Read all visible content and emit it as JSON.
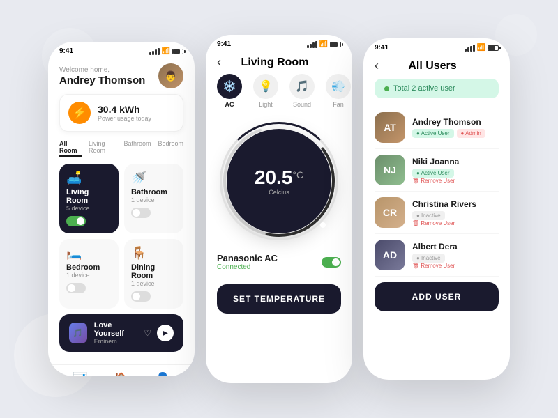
{
  "background": "#e8eaf0",
  "phone1": {
    "time": "9:41",
    "welcome": "Welcome home,",
    "userName": "Andrey Thomson",
    "power": {
      "value": "30.4 kWh",
      "label": "Power usage today"
    },
    "tabs": [
      "All Room",
      "Living Room",
      "Bathroom",
      "Bedroom"
    ],
    "activeTab": "All Room",
    "rooms": [
      {
        "name": "Living Room",
        "devices": "5 device",
        "icon": "🛋️",
        "dark": true,
        "on": true
      },
      {
        "name": "Bathroom",
        "devices": "1 device",
        "icon": "🚿",
        "dark": false,
        "on": false
      },
      {
        "name": "Bedroom",
        "devices": "1 device",
        "icon": "🛏️",
        "dark": false,
        "on": false
      },
      {
        "name": "Dining Room",
        "devices": "1 device",
        "icon": "🪑",
        "dark": false,
        "on": false
      }
    ],
    "music": {
      "title": "Love Yourself",
      "artist": "Eminem"
    },
    "nav": [
      "analytics",
      "home",
      "profile"
    ]
  },
  "phone2": {
    "time": "9:41",
    "roomTitle": "Living Room",
    "deviceTabs": [
      {
        "label": "AC",
        "icon": "❄️",
        "active": true
      },
      {
        "label": "Light",
        "icon": "💡",
        "active": false
      },
      {
        "label": "Sound",
        "icon": "🎵",
        "active": false
      },
      {
        "label": "Fan",
        "icon": "💨",
        "active": false
      }
    ],
    "temperature": "20.5",
    "tempUnit": "°C",
    "tempLabel": "Celcius",
    "acName": "Panasonic AC",
    "acStatus": "Connected",
    "acOn": true,
    "setTempLabel": "SET TEMPERATURE"
  },
  "phone3": {
    "time": "9:41",
    "title": "All Users",
    "activeBadge": "Total 2 active user",
    "users": [
      {
        "name": "Andrey Thomson",
        "tags": [
          "Active User",
          "Admin"
        ],
        "colors": [
          "#8B6F4E",
          "#C4956A"
        ],
        "initials": "AT",
        "removeUser": false
      },
      {
        "name": "Niki Joanna",
        "tags": [
          "Active User"
        ],
        "colors": [
          "#6B8E6B",
          "#8FBE8F"
        ],
        "initials": "NJ",
        "removeUser": true
      },
      {
        "name": "Christina Rivers",
        "tags": [
          "Inactive"
        ],
        "colors": [
          "#B8956A",
          "#D4B08C"
        ],
        "initials": "CR",
        "removeUser": true
      },
      {
        "name": "Albert Dera",
        "tags": [
          "Inactive"
        ],
        "colors": [
          "#4A4A6A",
          "#7A7A9A"
        ],
        "initials": "AD",
        "removeUser": true
      }
    ],
    "addUserLabel": "ADD USER"
  }
}
